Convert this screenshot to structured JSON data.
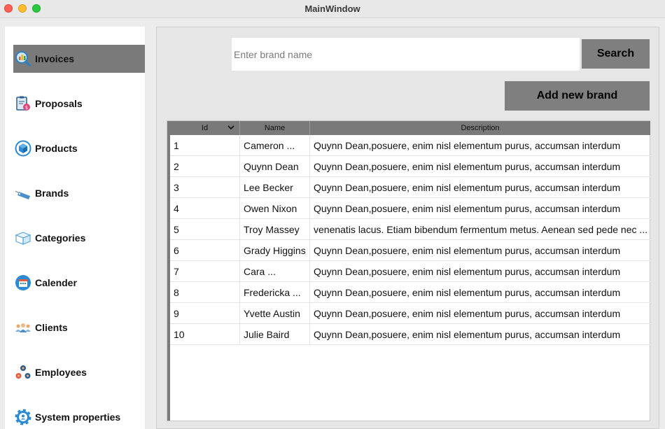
{
  "window": {
    "title": "MainWindow"
  },
  "sidebar": {
    "items": [
      {
        "label": "Invoices",
        "icon": "invoices-icon",
        "active": true
      },
      {
        "label": "Proposals",
        "icon": "proposals-icon",
        "active": false
      },
      {
        "label": "Products",
        "icon": "products-icon",
        "active": false
      },
      {
        "label": "Brands",
        "icon": "brands-icon",
        "active": false
      },
      {
        "label": "Categories",
        "icon": "categories-icon",
        "active": false
      },
      {
        "label": "Calender",
        "icon": "calendar-icon",
        "active": false
      },
      {
        "label": "Clients",
        "icon": "clients-icon",
        "active": false
      },
      {
        "label": "Employees",
        "icon": "employees-icon",
        "active": false
      },
      {
        "label": "System properties",
        "icon": "settings-icon",
        "active": false
      }
    ]
  },
  "search": {
    "placeholder": "Enter brand name",
    "value": "",
    "button_label": "Search"
  },
  "actions": {
    "add_label": "Add new brand"
  },
  "table": {
    "columns": [
      "Id",
      "Name",
      "Description"
    ],
    "rows": [
      {
        "id": "1",
        "name": "Cameron ...",
        "description": "Quynn Dean,posuere, enim nisl elementum purus, accumsan interdum"
      },
      {
        "id": "2",
        "name": "Quynn Dean",
        "description": "Quynn Dean,posuere, enim nisl elementum purus, accumsan interdum"
      },
      {
        "id": "3",
        "name": "Lee Becker",
        "description": "Quynn Dean,posuere, enim nisl elementum purus, accumsan interdum"
      },
      {
        "id": "4",
        "name": "Owen Nixon",
        "description": "Quynn Dean,posuere, enim nisl elementum purus, accumsan interdum"
      },
      {
        "id": "5",
        "name": "Troy Massey",
        "description": "venenatis lacus. Etiam bibendum fermentum metus. Aenean sed pede nec ..."
      },
      {
        "id": "6",
        "name": "Grady Higgins",
        "description": "Quynn Dean,posuere, enim nisl elementum purus, accumsan interdum"
      },
      {
        "id": "7",
        "name": "Cara ...",
        "description": "Quynn Dean,posuere, enim nisl elementum purus, accumsan interdum"
      },
      {
        "id": "8",
        "name": "Fredericka ...",
        "description": "Quynn Dean,posuere, enim nisl elementum purus, accumsan interdum"
      },
      {
        "id": "9",
        "name": "Yvette Austin",
        "description": "Quynn Dean,posuere, enim nisl elementum purus, accumsan interdum"
      },
      {
        "id": "10",
        "name": "Julie Baird",
        "description": "Quynn Dean,posuere, enim nisl elementum purus, accumsan interdum"
      }
    ]
  },
  "colors": {
    "active_nav": "#7a7a7a",
    "button": "#7f7f7f",
    "header": "#7a7a7a"
  }
}
